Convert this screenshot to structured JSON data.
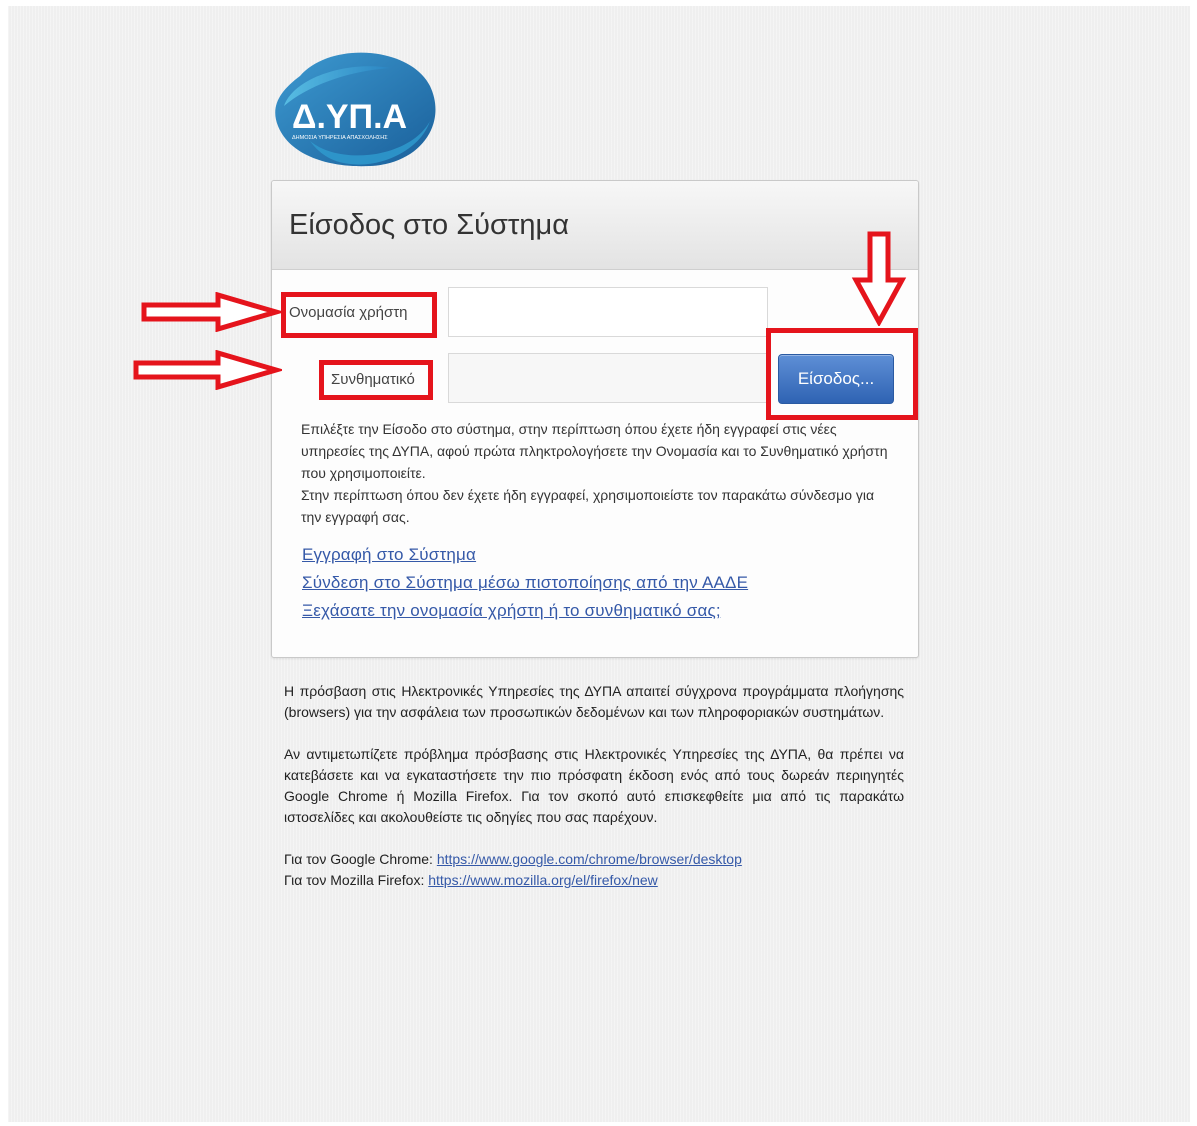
{
  "logo": {
    "text": "Δ.ΥΠ.Α",
    "subtitle": "ΔΗΜΟΣΙΑ ΥΠΗΡΕΣΙΑ ΑΠΑΣΧΟΛΗΣΗΣ"
  },
  "login": {
    "title": "Είσοδος στο Σύστημα",
    "username_label": "Ονομασία χρήστη",
    "username_value": "",
    "password_label": "Συνθηματικό",
    "password_value": "",
    "submit_label": "Είσοδος...",
    "help_lines": [
      "Επιλέξτε την Είσοδο στο σύστημα, στην περίπτωση όπου έχετε ήδη εγγραφεί στις νέες υπηρεσίες της ΔΥΠΑ, αφού πρώτα πληκτρολογήσετε την Ονομασία και το Συνθηματικό χρήστη που χρησιμοποιείτε.",
      "Στην περίπτωση όπου δεν έχετε ήδη εγγραφεί, χρησιμοποιείστε τον παρακάτω σύνδεσμο για την εγγραφή σας."
    ],
    "links": {
      "register": "Εγγραφή στο Σύστημα",
      "aade": "Σύνδεση στο Σύστημα μέσω πιστοποίησης από την ΑΑΔΕ",
      "forgot": "Ξεχάσατε την ονομασία χρήστη ή το συνθηματικό σας;"
    }
  },
  "info": {
    "paragraph1": "Η πρόσβαση στις Ηλεκτρονικές Υπηρεσίες της ΔΥΠΑ απαιτεί σύγχρονα προγράμματα πλοήγησης (browsers) για την ασφάλεια των προσωπικών δεδομένων και των πληροφοριακών συστημάτων.",
    "paragraph2": "Αν αντιμετωπίζετε πρόβλημα πρόσβασης στις Ηλεκτρονικές Υπηρεσίες της ΔΥΠΑ, θα πρέπει να κατεβάσετε και να εγκαταστήσετε την πιο πρόσφατη έκδοση ενός από τους δωρεάν περιηγητές Google Chrome ή Mozilla Firefox. Για τον σκοπό αυτό επισκεφθείτε μια από τις παρακάτω ιστοσελίδες και ακολουθείστε τις οδηγίες που σας παρέχουν.",
    "chrome_prefix": "Για τον Google Chrome: ",
    "chrome_url": "https://www.google.com/chrome/browser/desktop",
    "firefox_prefix": "Για τον Mozilla Firefox: ",
    "firefox_url": "https://www.mozilla.org/el/firefox/new"
  },
  "colors": {
    "annotation": "#e5141c",
    "link": "#3559a8",
    "button": "#3a6cc0"
  }
}
